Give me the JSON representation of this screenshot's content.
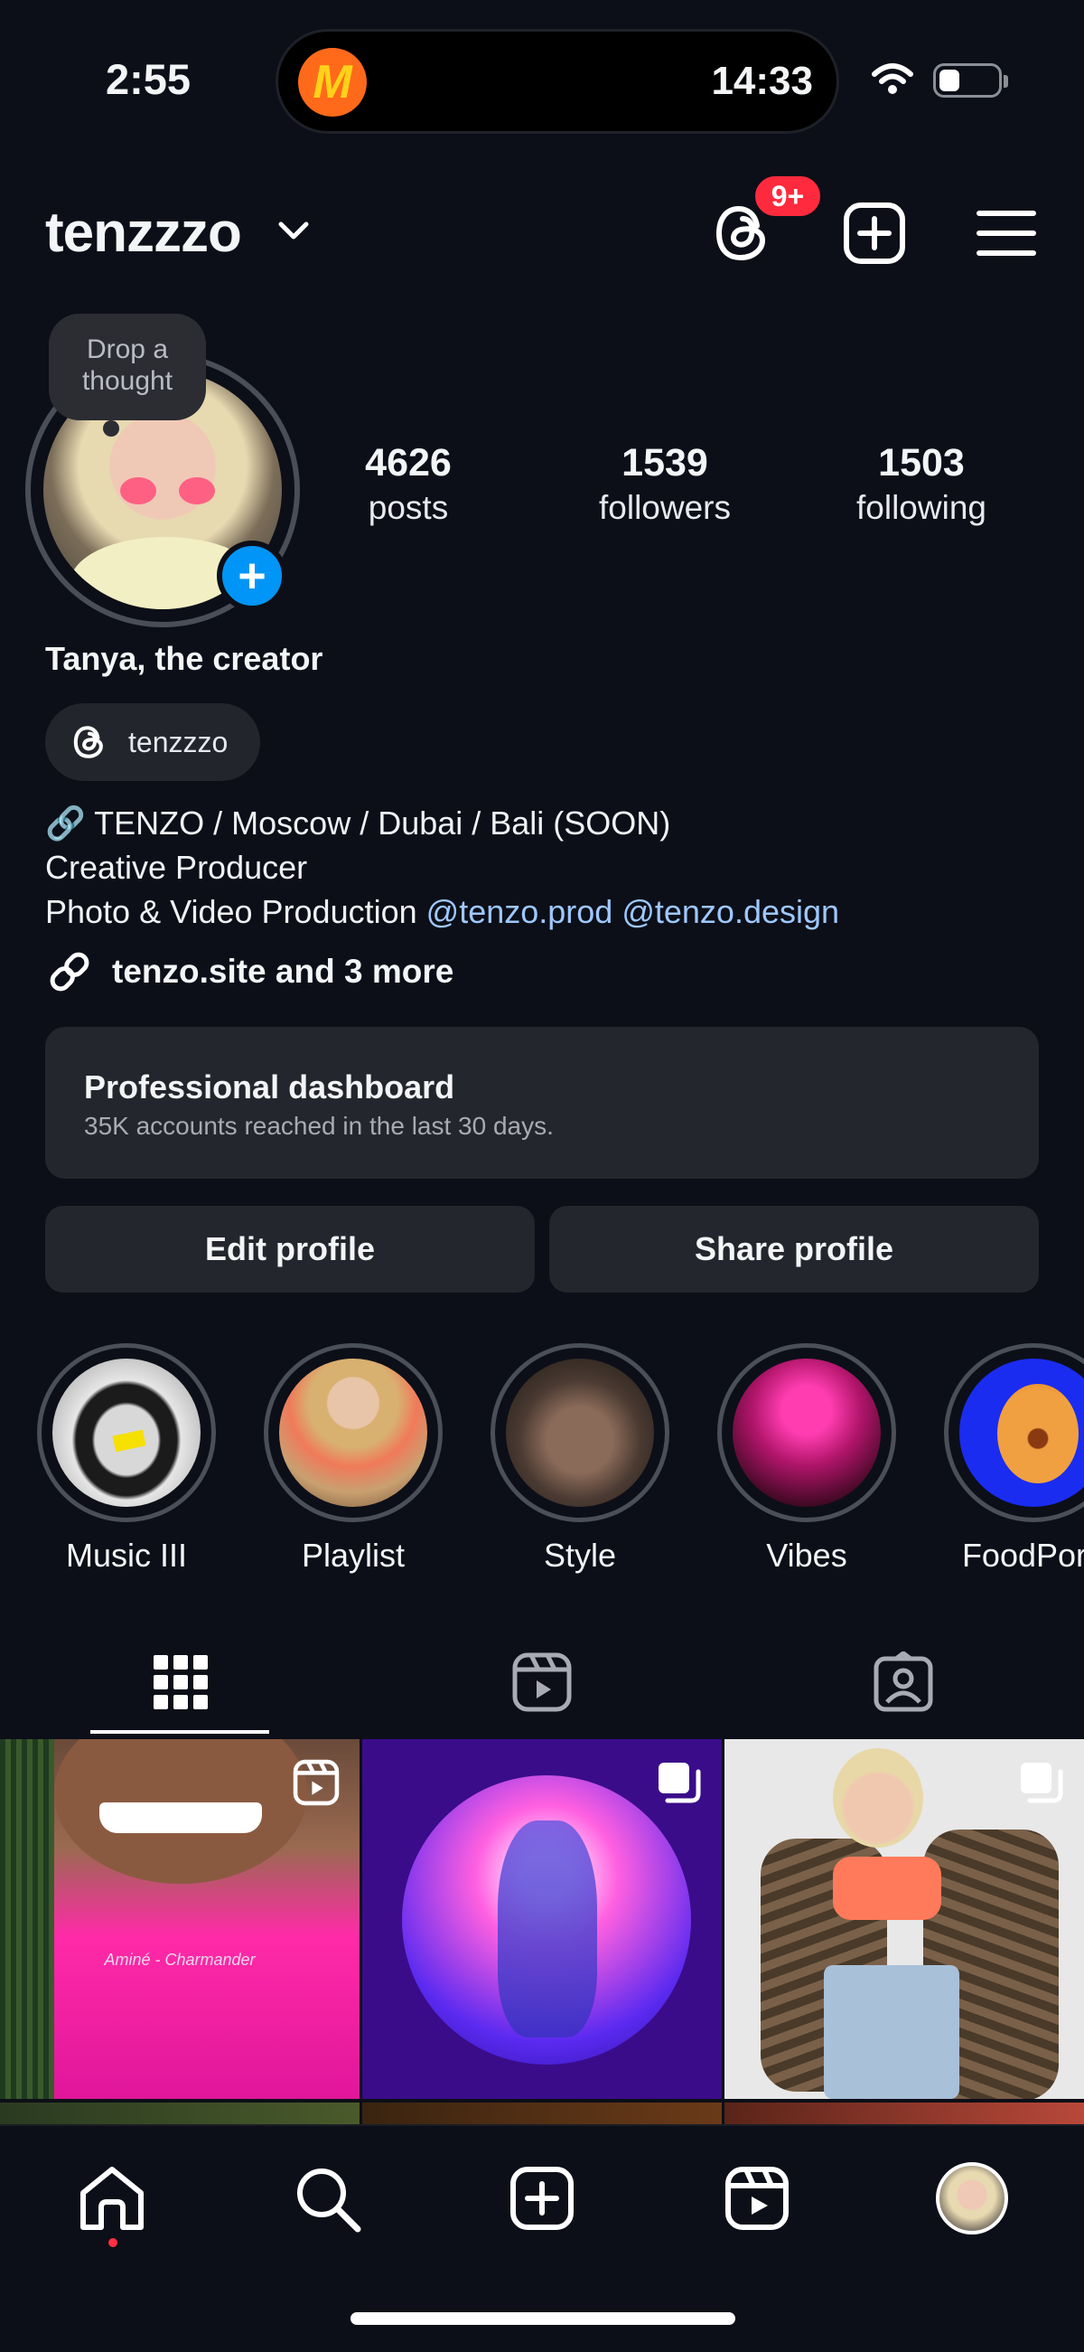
{
  "status_bar": {
    "time": "2:55",
    "island_time": "14:33",
    "island_app_logo": "M"
  },
  "header": {
    "username": "tenzzzo",
    "threads_badge": "9+",
    "icons": [
      "threads-icon",
      "create-icon",
      "menu-icon"
    ]
  },
  "profile": {
    "note_placeholder": "Drop a thought",
    "stats": [
      {
        "value": "4626",
        "label": "posts"
      },
      {
        "value": "1539",
        "label": "followers"
      },
      {
        "value": "1503",
        "label": "following"
      }
    ],
    "display_name": "Tanya, the creator",
    "threads_handle": "tenzzzo",
    "bio_line1": "🔗 TENZO / Moscow / Dubai / Bali (SOON)",
    "bio_line2": "Creative Producer",
    "bio_line3_prefix": "Photo & Video Production",
    "bio_mention1": "@tenzo.prod",
    "bio_mention2": "@tenzo.design",
    "links": "tenzo.site and 3 more"
  },
  "dashboard": {
    "title": "Professional dashboard",
    "subtitle": "35K accounts reached in the last 30 days."
  },
  "buttons": {
    "edit": "Edit profile",
    "share": "Share profile"
  },
  "highlights": [
    {
      "label": "Music III"
    },
    {
      "label": "Playlist"
    },
    {
      "label": "Style"
    },
    {
      "label": "Vibes"
    },
    {
      "label": "FoodPorn"
    }
  ],
  "tabs": [
    "grid-icon",
    "reels-icon",
    "tagged-icon"
  ],
  "posts": [
    {
      "type": "reel",
      "caption": "Aminé - Charmander"
    },
    {
      "type": "carousel",
      "caption": ""
    },
    {
      "type": "carousel",
      "caption": ""
    }
  ],
  "colors": {
    "background": "#0c0f18",
    "accent": "#0095f6",
    "badge": "#ff2a3d",
    "mention": "#9ec8ff"
  }
}
